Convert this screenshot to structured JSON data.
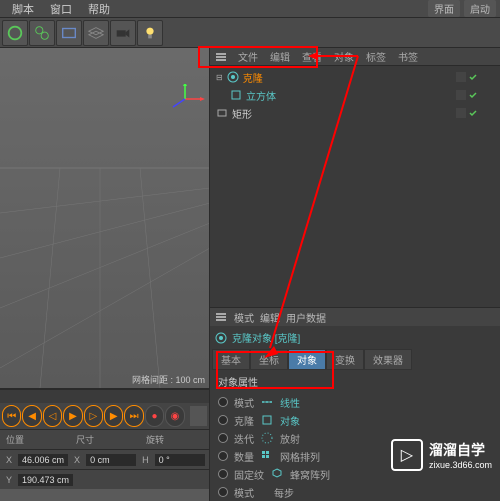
{
  "menu": {
    "script": "脚本",
    "window": "窗口",
    "help": "帮助",
    "interface": "界面",
    "startup": "启动"
  },
  "panel_tabs": {
    "file": "文件",
    "edit": "编辑",
    "view": "查看",
    "object": "对象",
    "tag": "标签",
    "bookmark": "书签"
  },
  "hierarchy": {
    "items": [
      {
        "label": "克隆",
        "type": "cloner"
      },
      {
        "label": "立方体",
        "type": "cube"
      },
      {
        "label": "矩形",
        "type": "rect"
      }
    ]
  },
  "viewport": {
    "grid_status": "网格间距 : 100 cm"
  },
  "coords": {
    "position": "位置",
    "size": "尺寸",
    "rotation": "旋转",
    "x_label": "X",
    "x_val": "46.006 cm",
    "y_label": "Y",
    "y_val": "190.473 cm",
    "x2_label": "X",
    "x2_val": "0 cm",
    "h_label": "H",
    "h_val": "0 °"
  },
  "attr": {
    "mode": "模式",
    "edit": "编辑",
    "userdata": "用户数据",
    "title": "克隆对象 [克隆]",
    "tabs": {
      "basic": "基本",
      "coord": "坐标",
      "object": "对象",
      "transform": "变换",
      "effector": "效果器"
    },
    "section": "对象属性",
    "mode_label": "模式",
    "linear": "线性",
    "clone": "克隆",
    "object_opt": "对象",
    "iterate": "迭代",
    "radial": "放射",
    "count": "数量",
    "grid_array": "网格排列",
    "fixed": "固定纹",
    "honeycomb": "蜂窝阵列",
    "mode2": "模式",
    "step": "每步"
  },
  "watermark": {
    "brand": "溜溜自学",
    "url": "zixue.3d66.com"
  }
}
